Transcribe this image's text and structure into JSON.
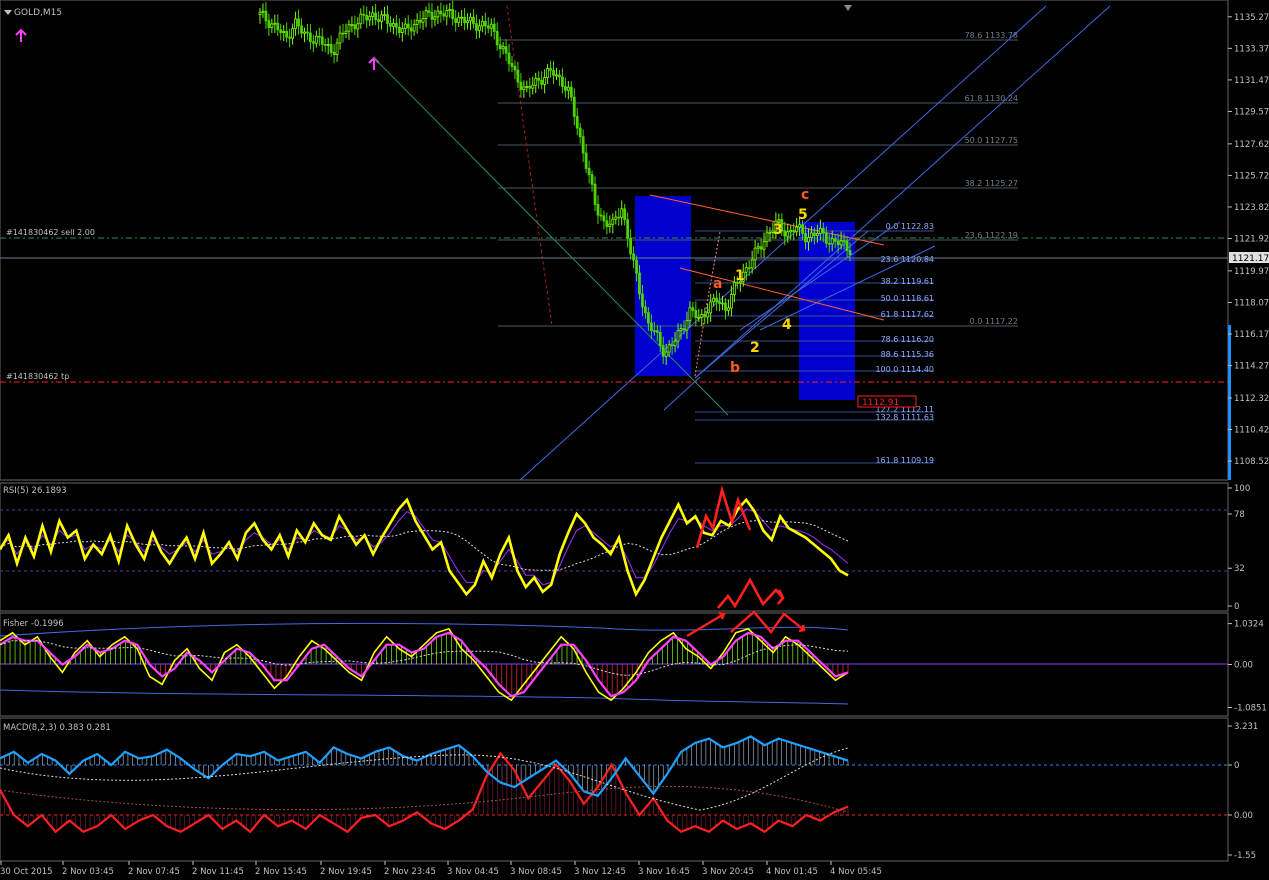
{
  "colors": {
    "background": "#000000",
    "grid": "#2f4f4f",
    "axis_text": "#c0c0c0",
    "bull_candle": "#7cfc00",
    "fib": "#6a7a86",
    "fib_text": "#707f8a",
    "fib_text_blue": "#6c8cff",
    "channel": "#4169e1",
    "zone": "#0000e0",
    "order_line": "#2e8b57",
    "tp_line": "#ff2020",
    "wave_yellow": "#ffd700",
    "wave_orange": "#ff5a1f",
    "rsi_main": "#ffff00",
    "rsi_signal": "#9b30ff",
    "fisher_line": "#ff40ff",
    "macd_main": "#1ea0ff",
    "macd_signal": "#ff2020",
    "price_tag": "#ff1a1a"
  },
  "header": {
    "symbol_label": "GOLD,M15",
    "arrow_icon": "triangle-down-icon"
  },
  "order": {
    "sell_label": "#141830462 sell 2.00",
    "tp_label": "#141830462 tp",
    "current_price": "1121.17",
    "red_tag": "1112.91"
  },
  "waves": {
    "labels_yellow": [
      "1",
      "2",
      "3",
      "4",
      "5"
    ],
    "labels_orange": [
      "a",
      "b",
      "c"
    ]
  },
  "fib_levels_upper": [
    "78.6  1133.78",
    "61.8  1130.24",
    "50.0  1127.75",
    "38.2  1125.27",
    "23.6  1122.19",
    "0.0  1117.22"
  ],
  "fib_levels_lower": [
    "0.0  1122.83",
    "23.6  1120.84",
    "38.2  1119.61",
    "50.0  1118.61",
    "61.8  1117.62",
    "78.6  1116.20",
    "88.6  1115.36",
    "100.0  1114.40",
    "127.2  1112.11",
    "132.8  1111.63",
    "161.8  1109.19"
  ],
  "x_axis_labels": [
    "30 Oct 2015",
    "2 Nov 03:45",
    "2 Nov 07:45",
    "2 Nov 11:45",
    "2 Nov 15:45",
    "2 Nov 19:45",
    "2 Nov 23:45",
    "3 Nov 04:45",
    "3 Nov 08:45",
    "3 Nov 12:45",
    "3 Nov 16:45",
    "3 Nov 20:45",
    "4 Nov 01:45",
    "4 Nov 05:45"
  ],
  "chart_data": [
    {
      "type": "candlestick",
      "title": "GOLD,M15",
      "y_ticks": [
        "1135.27",
        "1133.37",
        "1131.47",
        "1129.57",
        "1127.62",
        "1125.72",
        "1123.82",
        "1121.92",
        "1119.97",
        "1118.07",
        "1116.17",
        "1114.27",
        "1112.32",
        "1110.42",
        "1108.52"
      ],
      "ylim": [
        1107.5,
        1135.8
      ],
      "current_price": 1121.17,
      "close_path": [
        [
          0,
          1135.4
        ],
        [
          12,
          1134.6
        ],
        [
          18,
          1133.9
        ],
        [
          24,
          1135.0
        ],
        [
          30,
          1134.2
        ],
        [
          40,
          1133.9
        ],
        [
          50,
          1133.2
        ],
        [
          60,
          1134.6
        ],
        [
          70,
          1135.1
        ],
        [
          78,
          1135.4
        ],
        [
          90,
          1134.9
        ],
        [
          100,
          1134.4
        ],
        [
          112,
          1135.2
        ],
        [
          122,
          1135.5
        ],
        [
          132,
          1135.4
        ],
        [
          142,
          1135.0
        ],
        [
          152,
          1134.8
        ],
        [
          160,
          1134.6
        ],
        [
          166,
          1133.6
        ],
        [
          172,
          1132.6
        ],
        [
          178,
          1131.6
        ],
        [
          184,
          1130.7
        ],
        [
          190,
          1131.4
        ],
        [
          196,
          1131.6
        ],
        [
          202,
          1132.0
        ],
        [
          208,
          1131.5
        ],
        [
          214,
          1130.6
        ],
        [
          220,
          1128.5
        ],
        [
          226,
          1126.2
        ],
        [
          232,
          1123.9
        ],
        [
          238,
          1122.9
        ],
        [
          244,
          1122.7
        ],
        [
          250,
          1123.9
        ],
        [
          256,
          1121.2
        ],
        [
          262,
          1119.0
        ],
        [
          268,
          1116.8
        ],
        [
          274,
          1116.1
        ],
        [
          280,
          1115.0
        ],
        [
          286,
          1115.6
        ],
        [
          292,
          1116.6
        ],
        [
          298,
          1117.6
        ],
        [
          304,
          1117.0
        ],
        [
          310,
          1117.8
        ],
        [
          316,
          1118.2
        ],
        [
          322,
          1117.7
        ],
        [
          328,
          1118.9
        ],
        [
          334,
          1119.8
        ],
        [
          340,
          1120.7
        ],
        [
          346,
          1121.4
        ],
        [
          352,
          1122.4
        ],
        [
          358,
          1122.8
        ],
        [
          364,
          1122.2
        ],
        [
          370,
          1122.6
        ],
        [
          378,
          1122.0
        ],
        [
          386,
          1122.3
        ],
        [
          394,
          1121.8
        ],
        [
          402,
          1121.6
        ],
        [
          408,
          1121.3
        ]
      ]
    },
    {
      "type": "line",
      "title": "RSI(5) 26.1893",
      "y_ticks": [
        "100",
        "78",
        "32",
        "0"
      ],
      "ylim": [
        0,
        100
      ],
      "series": [
        {
          "values": [
            48,
            60,
            36,
            58,
            42,
            68,
            46,
            72,
            58,
            64,
            40,
            52,
            44,
            60,
            38,
            68,
            52,
            40,
            62,
            46,
            36,
            48,
            58,
            40,
            62,
            36,
            44,
            54,
            40,
            62,
            70,
            56,
            48,
            60,
            42,
            64,
            54,
            70,
            60,
            56,
            76,
            64,
            52,
            60,
            44,
            58,
            70,
            82,
            90,
            72,
            60,
            48,
            54,
            30,
            20,
            10,
            18,
            38,
            24,
            44,
            58,
            30,
            16,
            24,
            12,
            18,
            44,
            62,
            78,
            70,
            58,
            52,
            44,
            58,
            30,
            10,
            22,
            40,
            58,
            72,
            86,
            70,
            76,
            62,
            60,
            72,
            68,
            82,
            90,
            80,
            64,
            56,
            76,
            66,
            62,
            58,
            52,
            46,
            40,
            30,
            26
          ]
        },
        {
          "values": [
            50,
            56,
            44,
            54,
            48,
            60,
            52,
            64,
            58,
            60,
            48,
            52,
            48,
            56,
            46,
            60,
            54,
            46,
            56,
            50,
            44,
            48,
            54,
            46,
            56,
            44,
            46,
            50,
            46,
            56,
            62,
            58,
            52,
            56,
            48,
            58,
            56,
            64,
            60,
            58,
            68,
            64,
            56,
            58,
            50,
            54,
            62,
            72,
            80,
            76,
            66,
            56,
            54,
            42,
            30,
            20,
            20,
            30,
            28,
            38,
            48,
            38,
            26,
            26,
            18,
            20,
            34,
            50,
            64,
            68,
            62,
            56,
            50,
            54,
            40,
            24,
            24,
            34,
            48,
            62,
            74,
            72,
            74,
            68,
            64,
            68,
            68,
            74,
            82,
            80,
            72,
            64,
            68,
            66,
            64,
            62,
            58,
            52,
            48,
            42,
            36
          ]
        }
      ]
    },
    {
      "type": "line",
      "title": "Fisher -0.1996",
      "y_ticks": [
        "1.0324",
        "0.00",
        "-1.0851"
      ],
      "ylim": [
        -1.3,
        1.3
      ],
      "series": [
        {
          "values": [
            0.6,
            0.8,
            0.5,
            0.7,
            0.2,
            -0.2,
            0.3,
            0.6,
            0.2,
            0.5,
            0.7,
            0.4,
            -0.3,
            -0.5,
            0.1,
            0.4,
            -0.1,
            -0.4,
            0.3,
            0.5,
            0.2,
            -0.2,
            -0.6,
            -0.3,
            0.2,
            0.6,
            0.4,
            0.1,
            -0.2,
            -0.4,
            0.3,
            0.7,
            0.4,
            0.2,
            0.5,
            0.8,
            0.9,
            0.4,
            0.1,
            -0.3,
            -0.7,
            -0.9,
            -0.5,
            -0.1,
            0.3,
            0.7,
            0.4,
            -0.2,
            -0.7,
            -0.9,
            -0.6,
            -0.2,
            0.3,
            0.6,
            0.8,
            0.4,
            0.2,
            -0.1,
            0.3,
            0.8,
            0.9,
            0.6,
            0.3,
            0.7,
            0.5,
            0.2,
            -0.1,
            -0.4,
            -0.2
          ]
        },
        {
          "values": [
            0.5,
            0.7,
            0.6,
            0.6,
            0.3,
            0.0,
            0.2,
            0.5,
            0.3,
            0.4,
            0.6,
            0.5,
            0.0,
            -0.3,
            -0.1,
            0.3,
            0.1,
            -0.2,
            0.1,
            0.4,
            0.3,
            0.0,
            -0.4,
            -0.4,
            0.0,
            0.4,
            0.5,
            0.2,
            -0.1,
            -0.3,
            0.1,
            0.5,
            0.5,
            0.3,
            0.4,
            0.7,
            0.8,
            0.6,
            0.2,
            -0.1,
            -0.5,
            -0.8,
            -0.7,
            -0.3,
            0.1,
            0.5,
            0.5,
            0.1,
            -0.4,
            -0.8,
            -0.7,
            -0.4,
            0.1,
            0.4,
            0.7,
            0.6,
            0.3,
            0.0,
            0.2,
            0.6,
            0.8,
            0.7,
            0.4,
            0.6,
            0.6,
            0.3,
            0.0,
            -0.3,
            -0.2
          ]
        }
      ]
    },
    {
      "type": "line",
      "title": "MACD(8,2,3) 0.383 0.281",
      "y_ticks": [
        "3.231",
        "0",
        "0.00",
        "-1.55"
      ],
      "ylim": [
        -1.6,
        3.3
      ],
      "series": [
        {
          "values": [
            0.3,
            0.6,
            0.1,
            0.5,
            0.2,
            -0.4,
            0.2,
            0.5,
            0.0,
            0.6,
            0.3,
            0.4,
            0.7,
            0.3,
            -0.2,
            -0.6,
            0.0,
            0.5,
            0.4,
            0.6,
            0.2,
            0.4,
            0.6,
            0.1,
            0.8,
            0.5,
            0.3,
            0.6,
            0.8,
            0.4,
            0.2,
            0.5,
            0.7,
            0.9,
            0.4,
            -0.3,
            -0.8,
            -1.0,
            -0.6,
            -0.2,
            0.2,
            -0.4,
            -1.2,
            -1.4,
            -0.6,
            0.3,
            -0.5,
            -1.3,
            -0.4,
            0.6,
            1.0,
            1.2,
            0.8,
            1.0,
            1.3,
            0.9,
            1.2,
            1.0,
            0.8,
            0.6,
            0.4,
            0.2
          ]
        },
        {
          "values": [
            -0.1,
            -1.0,
            -1.4,
            -1.0,
            -1.6,
            -1.2,
            -1.6,
            -1.4,
            -1.0,
            -1.5,
            -1.2,
            -1.0,
            -1.4,
            -1.6,
            -1.3,
            -1.0,
            -1.5,
            -1.2,
            -1.6,
            -1.0,
            -1.4,
            -1.2,
            -1.5,
            -1.0,
            -1.3,
            -1.6,
            -1.1,
            -1.0,
            -1.4,
            -1.2,
            -0.9,
            -1.3,
            -1.5,
            -1.2,
            -0.8,
            0.4,
            1.2,
            0.6,
            -0.4,
            0.2,
            0.8,
            0.2,
            -0.6,
            0.0,
            0.8,
            -0.2,
            -1.0,
            -0.4,
            -1.2,
            -1.6,
            -1.4,
            -1.6,
            -1.2,
            -1.5,
            -1.3,
            -1.6,
            -1.2,
            -1.4,
            -1.0,
            -1.2,
            -0.9,
            -0.7
          ]
        }
      ]
    }
  ]
}
